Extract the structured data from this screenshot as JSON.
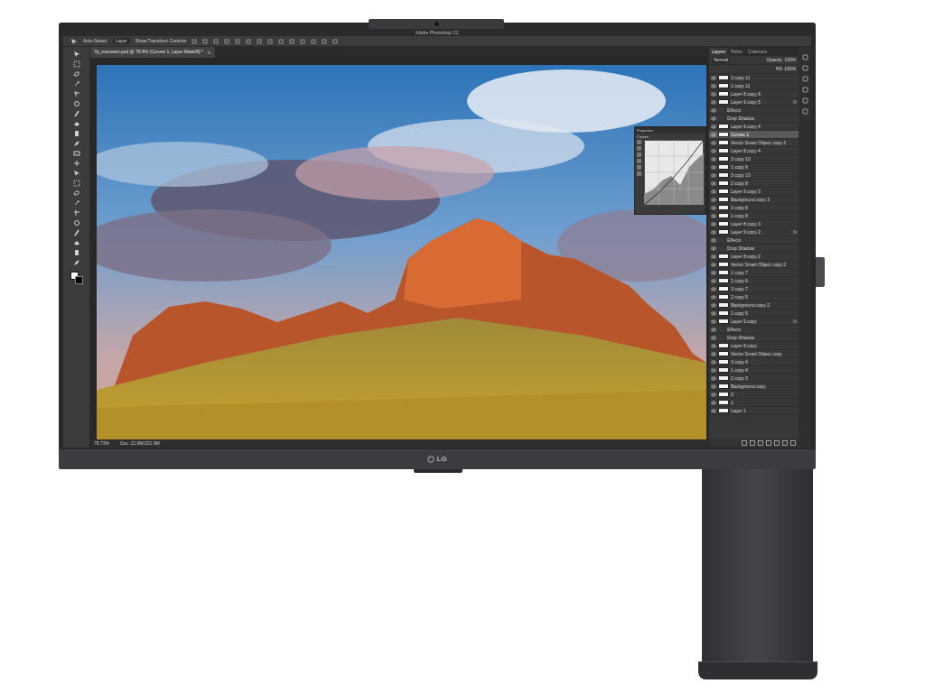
{
  "window": {
    "title": "Adobe Photoshop CC"
  },
  "brand": {
    "logo": "LG"
  },
  "options_bar": {
    "items": [
      "Auto-Select:",
      "Layer",
      "Show Transform Controls"
    ]
  },
  "document_tab": {
    "label": "7p_mecseen.psd @ 79.6% (Curves 1, Layer Mask/8) *",
    "selected": true
  },
  "panel_tabs": [
    {
      "label": "Layers",
      "selected": true
    },
    {
      "label": "Paths",
      "selected": false
    },
    {
      "label": "Channels",
      "selected": false
    }
  ],
  "layer_controls": {
    "blend_mode": "Normal",
    "opacity": "Opacity: 100%",
    "fill": "Fill: 100%"
  },
  "properties": {
    "title": "Properties",
    "preset": "Curves"
  },
  "layers": [
    {
      "name": "3 copy 11",
      "kind": "layer",
      "selected": false
    },
    {
      "name": "1 copy 11",
      "kind": "layer",
      "selected": false
    },
    {
      "name": "Layer 8 copy 6",
      "kind": "layer",
      "selected": false
    },
    {
      "name": "Layer 9 copy 5",
      "kind": "layer",
      "selected": false,
      "badge": "fx"
    },
    {
      "name": "Effects",
      "kind": "effect",
      "selected": false
    },
    {
      "name": "Drop Shadow",
      "kind": "effect",
      "selected": false
    },
    {
      "name": "Layer 9 copy 4",
      "kind": "layer",
      "selected": false
    },
    {
      "name": "Curves 1",
      "kind": "layer",
      "selected": true
    },
    {
      "name": "Vector Smart Object copy 3",
      "kind": "layer",
      "selected": false
    },
    {
      "name": "Layer 8 copy 4",
      "kind": "layer",
      "selected": false
    },
    {
      "name": "3 copy 10",
      "kind": "layer",
      "selected": false
    },
    {
      "name": "1 copy 9",
      "kind": "layer",
      "selected": false
    },
    {
      "name": "3 copy 10",
      "kind": "layer",
      "selected": false
    },
    {
      "name": "2 copy 8",
      "kind": "layer",
      "selected": false
    },
    {
      "name": "Layer 9 copy 3",
      "kind": "layer",
      "selected": false
    },
    {
      "name": "Background copy 3",
      "kind": "layer",
      "selected": false
    },
    {
      "name": "3 copy 8",
      "kind": "layer",
      "selected": false
    },
    {
      "name": "1 copy 8",
      "kind": "layer",
      "selected": false
    },
    {
      "name": "Layer 8 copy 3",
      "kind": "layer",
      "selected": false
    },
    {
      "name": "Layer 9 copy 2",
      "kind": "layer",
      "selected": false,
      "badge": "fx"
    },
    {
      "name": "Effects",
      "kind": "effect",
      "selected": false
    },
    {
      "name": "Drop Shadow",
      "kind": "effect",
      "selected": false
    },
    {
      "name": "Layer 8 copy 2",
      "kind": "layer",
      "selected": false
    },
    {
      "name": "Vector Smart Object copy 2",
      "kind": "layer",
      "selected": false
    },
    {
      "name": "1 copy 7",
      "kind": "layer",
      "selected": false
    },
    {
      "name": "1 copy 6",
      "kind": "layer",
      "selected": false
    },
    {
      "name": "3 copy 7",
      "kind": "layer",
      "selected": false
    },
    {
      "name": "2 copy 5",
      "kind": "layer",
      "selected": false
    },
    {
      "name": "Background copy 2",
      "kind": "layer",
      "selected": false
    },
    {
      "name": "1 copy 5",
      "kind": "layer",
      "selected": false
    },
    {
      "name": "Layer 9 copy",
      "kind": "layer",
      "selected": false,
      "badge": "fx"
    },
    {
      "name": "Effects",
      "kind": "effect",
      "selected": false
    },
    {
      "name": "Drop Shadow",
      "kind": "effect",
      "selected": false
    },
    {
      "name": "Layer 8 copy",
      "kind": "layer",
      "selected": false
    },
    {
      "name": "Vector Smart Object copy",
      "kind": "layer",
      "selected": false
    },
    {
      "name": "3 copy 4",
      "kind": "layer",
      "selected": false
    },
    {
      "name": "1 copy 4",
      "kind": "layer",
      "selected": false
    },
    {
      "name": "2 copy 3",
      "kind": "layer",
      "selected": false
    },
    {
      "name": "Background copy",
      "kind": "layer",
      "selected": false
    },
    {
      "name": "3",
      "kind": "layer",
      "selected": false
    },
    {
      "name": "1",
      "kind": "layer",
      "selected": false
    },
    {
      "name": "Layer 1",
      "kind": "layer",
      "selected": false
    }
  ],
  "status_bar": {
    "zoom": "78.73%",
    "doc": "Doc: 21.9M/201.9M"
  }
}
